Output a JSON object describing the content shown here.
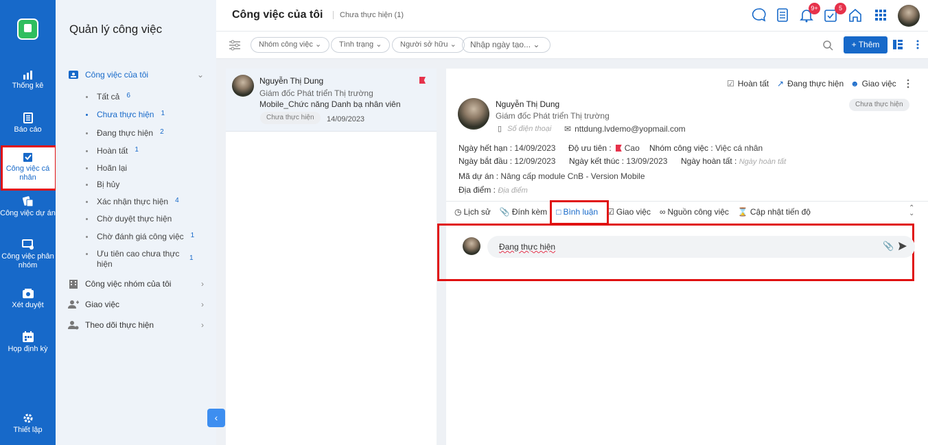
{
  "rail": {
    "items": [
      {
        "label": "Thống kê",
        "icon": "bar-chart-icon"
      },
      {
        "label": "Báo cáo",
        "icon": "report-icon"
      },
      {
        "label": "Công việc cá nhân",
        "icon": "personal-task-icon"
      },
      {
        "label": "Công việc dự án",
        "icon": "project-task-icon"
      },
      {
        "label": "Công việc phân nhóm",
        "icon": "group-task-icon"
      },
      {
        "label": "Xét duyệt",
        "icon": "approval-icon"
      },
      {
        "label": "Họp định kỳ",
        "icon": "calendar-icon"
      }
    ],
    "settings": "Thiết lập"
  },
  "sidebar": {
    "title": "Quản lý công việc",
    "my_tasks": "Công việc của tôi",
    "subs": [
      {
        "label": "Tất cả",
        "count": "6"
      },
      {
        "label": "Chưa thực hiện",
        "count": "1"
      },
      {
        "label": "Đang thực hiện",
        "count": "2"
      },
      {
        "label": "Hoàn tất",
        "count": "1"
      },
      {
        "label": "Hoãn lại",
        "count": ""
      },
      {
        "label": "Bị hủy",
        "count": ""
      },
      {
        "label": "Xác nhận thực hiện",
        "count": "4"
      },
      {
        "label": "Chờ duyệt thực hiện",
        "count": ""
      },
      {
        "label": "Chờ đánh giá công việc",
        "count": "1"
      },
      {
        "label": "Ưu tiên cao chưa thực hiện",
        "count": "1"
      }
    ],
    "groups": [
      "Công việc nhóm của tôi",
      "Giao việc",
      "Theo dõi thực hiện"
    ]
  },
  "header": {
    "title": "Công việc của tôi",
    "crumb": "Chưa thực hiện (1)",
    "notif_badge": "9+",
    "task_badge": "5"
  },
  "filters": {
    "group": "Nhóm công việc",
    "status": "Tình trạng",
    "owner": "Người sở hữu",
    "date": "Nhập ngày tạo...",
    "add": "+ Thêm"
  },
  "card": {
    "name": "Nguyễn Thị Dung",
    "role": "Giám đốc Phát triển Thị trường",
    "task": "Mobile_Chức năng Danh bạ nhân viên",
    "status": "Chưa thực hiện",
    "date": "14/09/2023"
  },
  "detail": {
    "actions": {
      "done": "Hoàn tất",
      "doing": "Đang thực hiện",
      "assign": "Giao việc"
    },
    "name": "Nguyễn Thị Dung",
    "role": "Giám đốc Phát triển Thị trường",
    "status": "Chưa thực hiện",
    "phone_ph": "Số điện thoại",
    "email": "nttdung.lvdemo@yopmail.com",
    "due_label": "Ngày hết hạn :",
    "due": "14/09/2023",
    "prio_label": "Độ ưu tiên :",
    "prio": "Cao",
    "group_label": "Nhóm công việc :",
    "group": "Việc cá nhân",
    "start_label": "Ngày bắt đầu :",
    "start": "12/09/2023",
    "end_label": "Ngày kết thúc :",
    "end": "13/09/2023",
    "done_label": "Ngày hoàn tất :",
    "done_ph": "Ngày hoàn tất",
    "proj_label": "Mã dự án :",
    "proj": "Nâng cấp module CnB - Version Mobile",
    "loc_label": "Địa điểm :",
    "loc_ph": "Địa điểm",
    "tabs": [
      "Lịch sử",
      "Đính kèm",
      "Bình luận",
      "Giao việc",
      "Nguồn công việc",
      "Cập nhật tiến độ"
    ],
    "comment": "Đang thực hiện"
  },
  "colors": {
    "primary": "#1769c9",
    "highlight": "#e01010",
    "badge": "#e6324b"
  }
}
